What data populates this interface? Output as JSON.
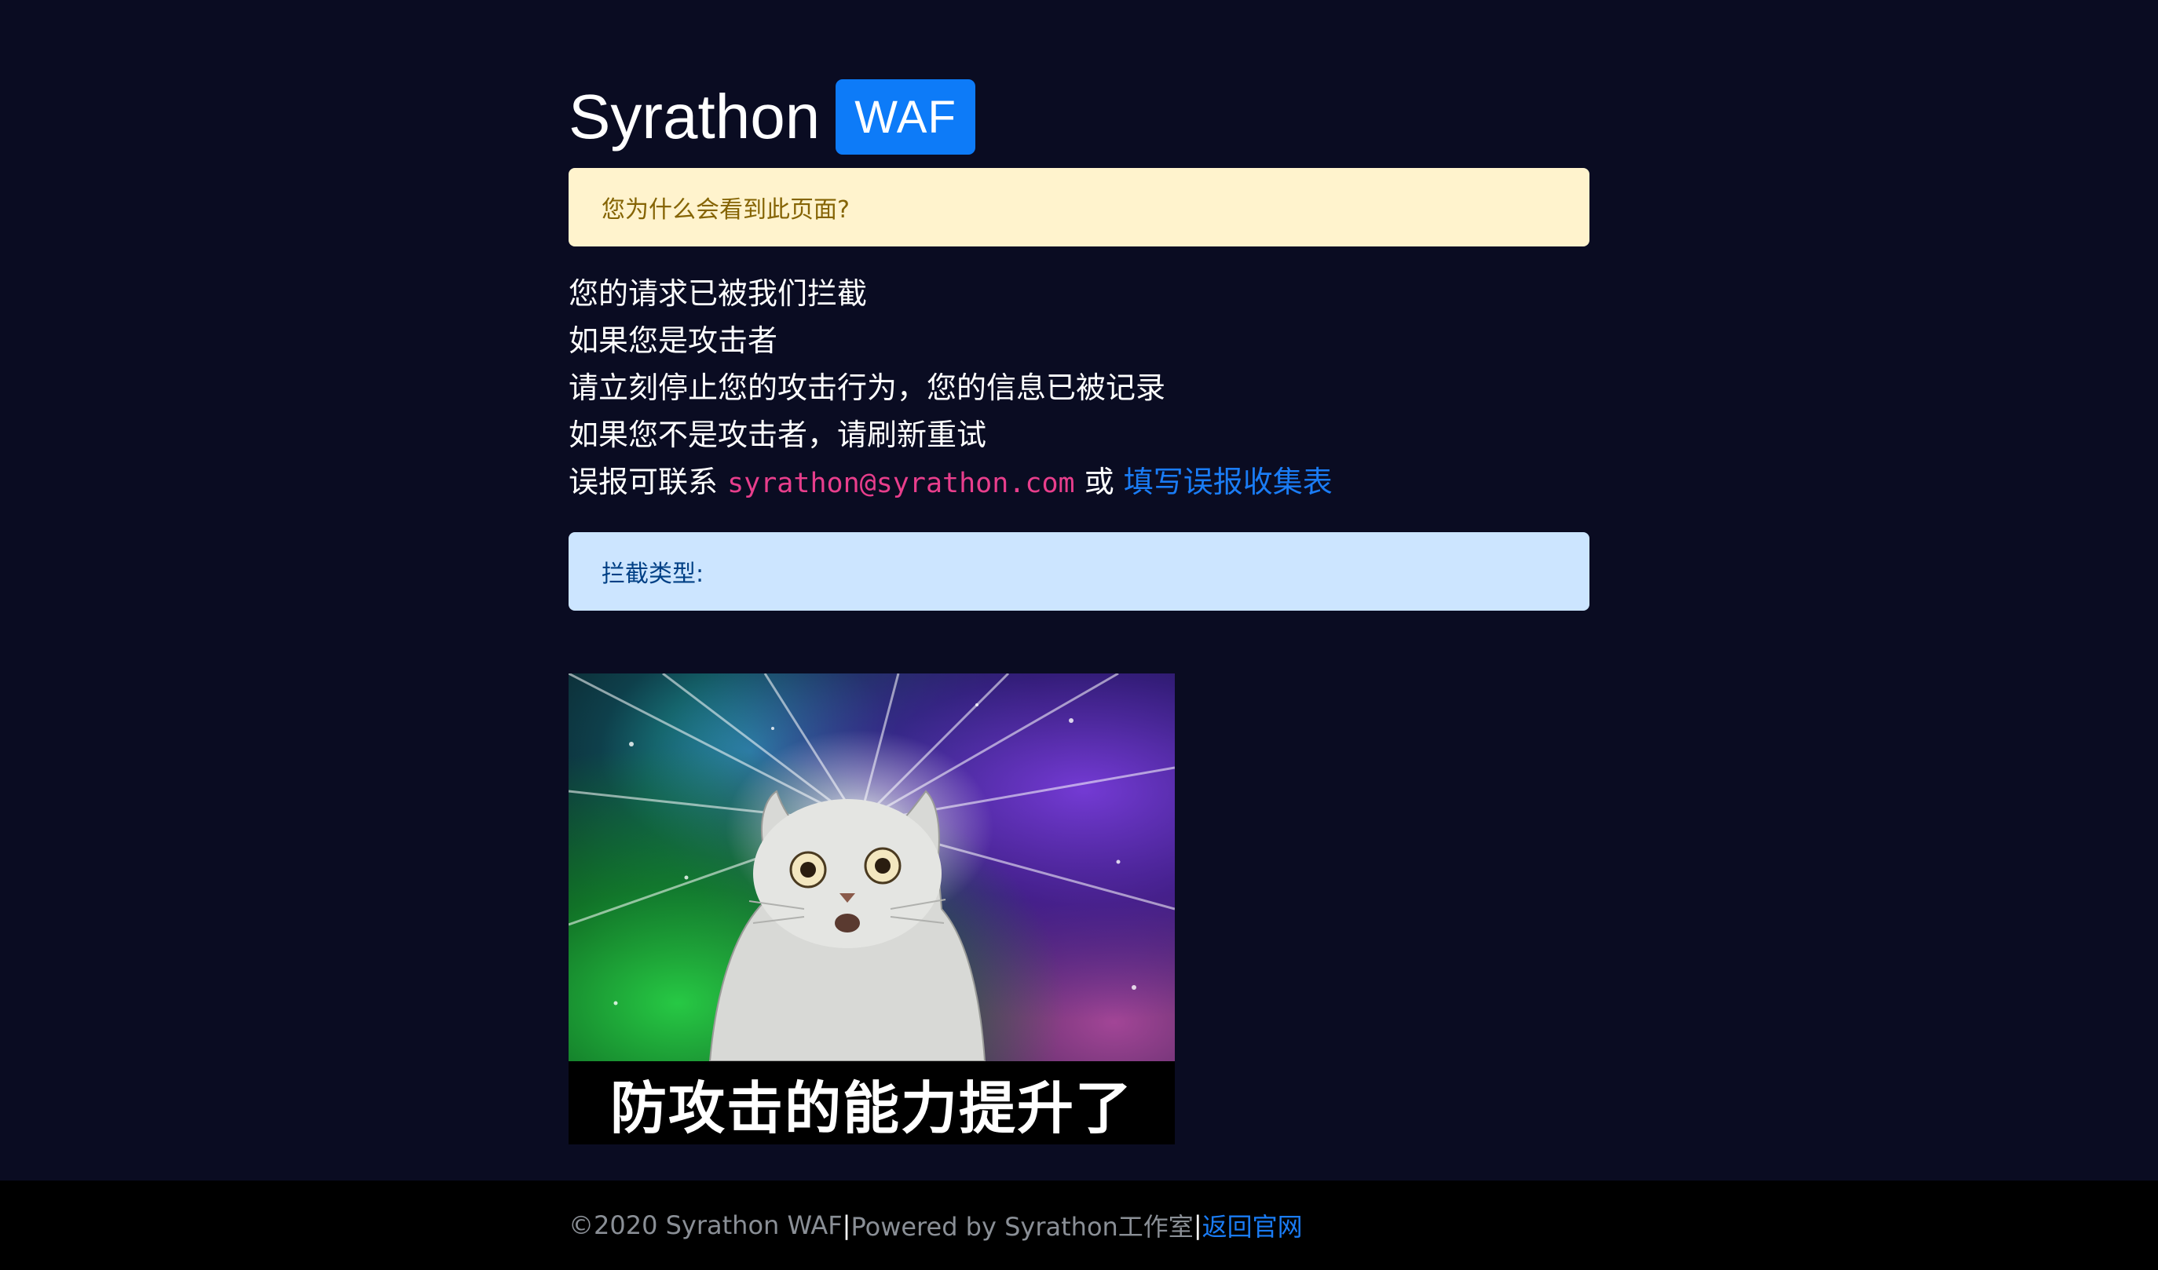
{
  "brand": {
    "name": "Syrathon",
    "badge": "WAF"
  },
  "warning_alert": {
    "text": "您为什么会看到此页面?"
  },
  "message": {
    "line1": "您的请求已被我们拦截",
    "line2": "如果您是攻击者",
    "line3": "请立刻停止您的攻击行为，您的信息已被记录",
    "line4": "如果您不是攻击者，请刷新重试",
    "line5_prefix": "误报可联系 ",
    "email": "syrathon@syrathon.com",
    "or": " 或 ",
    "report_link": "填写误报收集表"
  },
  "info_alert": {
    "text": "拦截类型:"
  },
  "meme": {
    "caption": "防攻击的能力提升了"
  },
  "footer": {
    "copyright": "©2020 Syrathon WAF",
    "sep1": " | ",
    "powered": "Powered by Syrathon工作室",
    "sep2": " | ",
    "back_link": "返回官网"
  },
  "colors": {
    "background": "#0a0c22",
    "badge": "#0d7bf8",
    "link": "#1a7cf5",
    "email": "#e83e8c"
  }
}
